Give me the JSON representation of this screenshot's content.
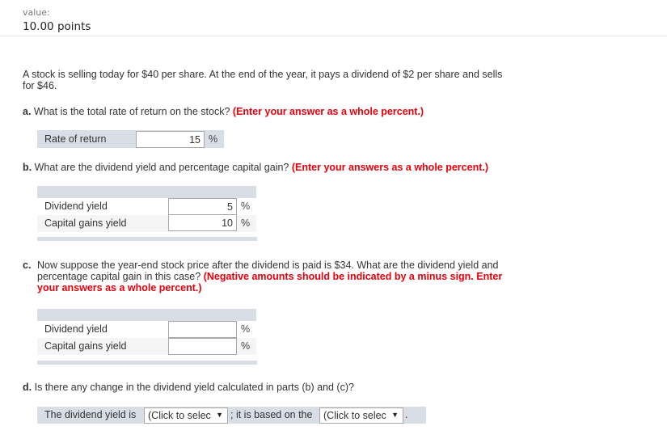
{
  "header": {
    "value_label": "value:",
    "points": "10.00 points"
  },
  "intro": "A stock is selling today for $40 per share. At the end of the year, it pays a dividend of $2 per share and sells for $46.",
  "part_a": {
    "letter": "a.",
    "question": "What is the total rate of return on the stock?",
    "instruction": "(Enter your answer as a whole percent.)",
    "rows": [
      {
        "label": "Rate of return",
        "value": "15",
        "unit": "%"
      }
    ]
  },
  "part_b": {
    "letter": "b.",
    "question": "What are the dividend yield and percentage capital gain?",
    "instruction": "(Enter your answers as a whole percent.)",
    "rows": [
      {
        "label": "Dividend yield",
        "value": "5",
        "unit": "%"
      },
      {
        "label": "Capital gains yield",
        "value": "10",
        "unit": "%"
      }
    ]
  },
  "part_c": {
    "letter": "c.",
    "question": "Now suppose the year-end stock price after the dividend is paid is $34. What are the dividend yield and percentage capital gain in this case?",
    "instruction": "(Negative amounts should be indicated by a minus sign. Enter your answers as a whole percent.)",
    "rows": [
      {
        "label": "Dividend yield",
        "value": "",
        "unit": "%"
      },
      {
        "label": "Capital gains yield",
        "value": "",
        "unit": "%"
      }
    ]
  },
  "part_d": {
    "letter": "d.",
    "question": "Is there any change in the dividend yield calculated in parts (b) and (c)?",
    "sentence_start": "The dividend yield is",
    "select1": "(Click to selec",
    "sentence_mid": "; it is based on the",
    "select2": "(Click to selec",
    "sentence_end": "."
  }
}
